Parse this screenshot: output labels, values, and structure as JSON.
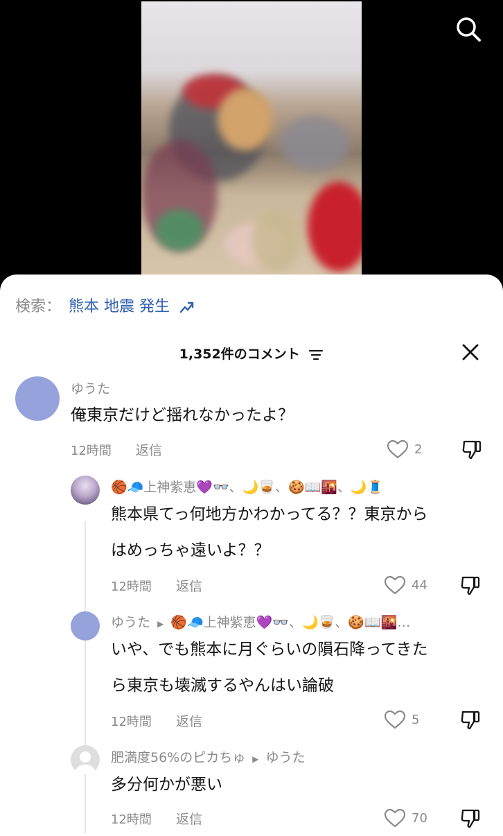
{
  "search_bar": {
    "prefix": "検索：",
    "query": "熊本 地震 発生"
  },
  "comments_header": {
    "title": "1,352件のコメント"
  },
  "comments": [
    {
      "user": "ゆうた",
      "text": "俺東京だけど揺れなかったよ？",
      "time": "12時間",
      "reply": "返信",
      "likes": "2"
    },
    {
      "user": "🏀🧢上神紫恵💜👓、🌙🥃、🍪📖🌇、🌙🧵",
      "text_line1": "熊本県てっ何地方かわかってる？？東京から",
      "text_line2": "はめっちゃ遠いよ？？",
      "time": "12時間",
      "reply": "返信",
      "likes": "44"
    },
    {
      "user": "ゆうた",
      "reply_to": "🏀🧢上神紫恵💜👓、🌙🥃、🍪📖🌇…",
      "text_line1": "いや、でも熊本に月ぐらいの隕石降ってきた",
      "text_line2": "ら東京も壊滅するやんはい論破",
      "time": "12時間",
      "reply": "返信",
      "likes": "5"
    },
    {
      "user": "肥満度56%のピカちゅ",
      "reply_to": "ゆうた",
      "text": "多分何かが悪い",
      "time": "12時間",
      "reply": "返信",
      "likes": "70"
    }
  ],
  "colors": {
    "accent": "#2c5fb0",
    "avatar_default": "#95a2dc",
    "muted": "#8a8a8a"
  }
}
